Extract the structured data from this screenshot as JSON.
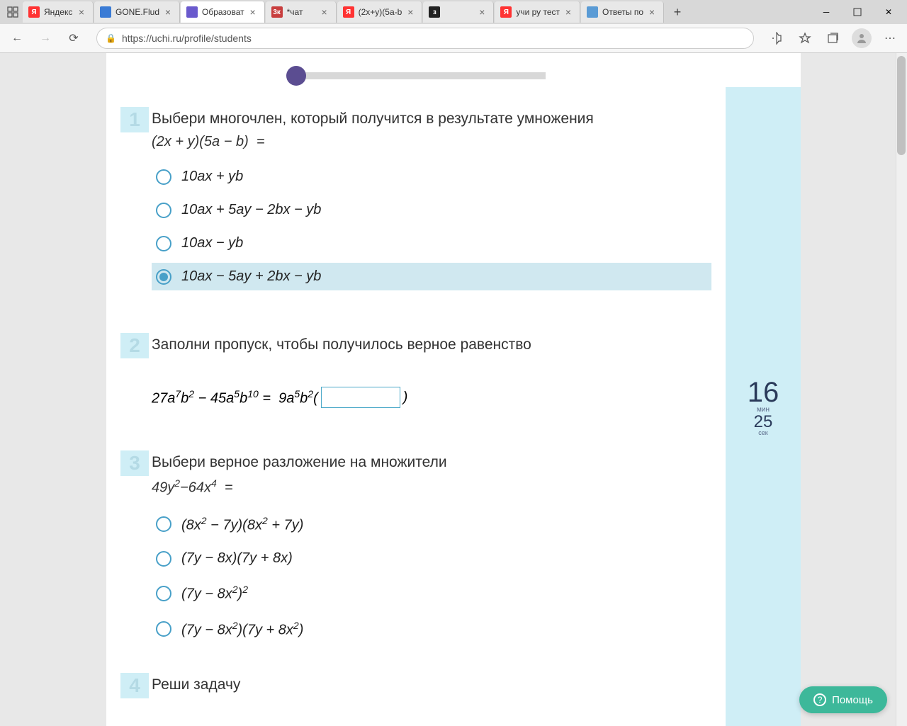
{
  "browser": {
    "tabs": [
      {
        "favicon_bg": "#ff3333",
        "favicon_txt": "Я",
        "title": "Яндекс"
      },
      {
        "favicon_bg": "#3a7bd5",
        "favicon_txt": "",
        "title": "GONE.Flud"
      },
      {
        "favicon_bg": "#6a5acd",
        "favicon_txt": "",
        "title": "Образоват"
      },
      {
        "favicon_bg": "#c83e3e",
        "favicon_txt": "3к",
        "title": "*чат"
      },
      {
        "favicon_bg": "#ff3333",
        "favicon_txt": "Я",
        "title": "(2x+y)(5a-b"
      },
      {
        "favicon_bg": "#222222",
        "favicon_txt": "з",
        "title": ""
      },
      {
        "favicon_bg": "#ff3333",
        "favicon_txt": "Я",
        "title": "учи ру тест"
      },
      {
        "favicon_bg": "#5a9bd5",
        "favicon_txt": "",
        "title": "Ответы по"
      }
    ],
    "active_tab_index": 2,
    "url": "https://uchi.ru/profile/students"
  },
  "timer": {
    "minutes": "16",
    "min_label": "мин",
    "seconds": "25",
    "sec_label": "сек"
  },
  "questions": [
    {
      "num": "1",
      "text": "Выбери многочлен, который получится в результате умножения",
      "options": [
        {
          "html": "10<i>ax</i> + <i>yb</i>",
          "selected": false
        },
        {
          "html": "10<i>ax</i> + 5<i>ay</i> − 2<i>bx</i> − <i>yb</i>",
          "selected": false
        },
        {
          "html": "10<i>ax</i> − <i>yb</i>",
          "selected": false
        },
        {
          "html": "10<i>ax</i> − 5<i>ay</i> + 2<i>bx</i> − <i>yb</i>",
          "selected": true
        }
      ]
    },
    {
      "num": "2",
      "text": "Заполни пропуск, чтобы получилось верное равенство"
    },
    {
      "num": "3",
      "text": "Выбери верное разложение на множители",
      "options": [
        {
          "html": "(8<i>x</i><sup>2</sup> − 7<i>y</i>)(8<i>x</i><sup>2</sup> + 7<i>y</i>)",
          "selected": false
        },
        {
          "html": "(7<i>y</i> − 8<i>x</i>)(7<i>y</i> + 8<i>x</i>)",
          "selected": false
        },
        {
          "html": "(7<i>y</i> − 8<i>x</i><sup>2</sup>)<sup>2</sup>",
          "selected": false
        },
        {
          "html": "(7<i>y</i> − 8<i>x</i><sup>2</sup>)(7<i>y</i> + 8<i>x</i><sup>2</sup>)",
          "selected": false
        }
      ]
    },
    {
      "num": "4",
      "text": "Реши задачу"
    }
  ],
  "help_label": "Помощь"
}
